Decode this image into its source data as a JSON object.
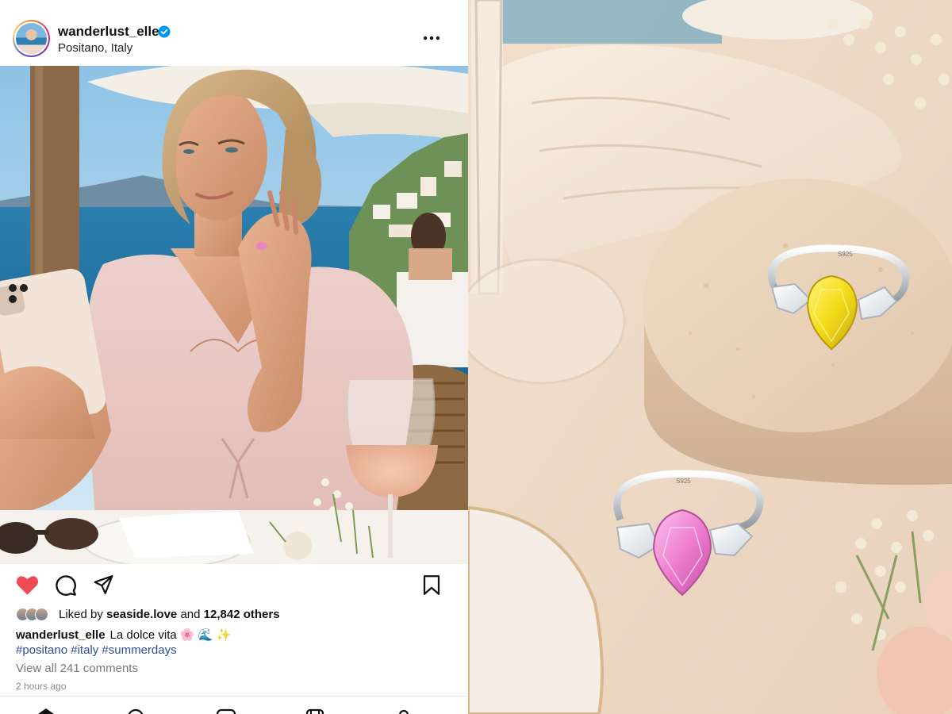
{
  "post": {
    "username": "wanderlust_elle",
    "location": "Positano, Italy",
    "likes_prefix": "Liked by",
    "liked_by": "seaside.love",
    "likes_connector": "and",
    "likes_others": "12,842 others",
    "caption_user": "wanderlust_elle",
    "caption_text": "La dolce vita 🌸 🌊 ✨",
    "hashtags": "#positano #italy #summerdays",
    "view_comments": "View all 241 comments",
    "time_ago": "2 hours ago",
    "liked": true
  },
  "icons": {
    "verified": "verified-badge-icon",
    "more": "more-options-icon",
    "like": "heart-icon",
    "comment": "comment-icon",
    "share": "share-icon",
    "save": "bookmark-icon",
    "nav": [
      "home-icon",
      "search-icon",
      "reels-icon",
      "shop-icon",
      "profile-icon"
    ]
  },
  "ring_engraving": "S925",
  "colors": {
    "heart": "#ed4956",
    "verified": "#0095f6",
    "hashtag": "#2a4f9a",
    "pink_gem": "#ee7fcf",
    "yellow_gem": "#f3dc1a"
  }
}
